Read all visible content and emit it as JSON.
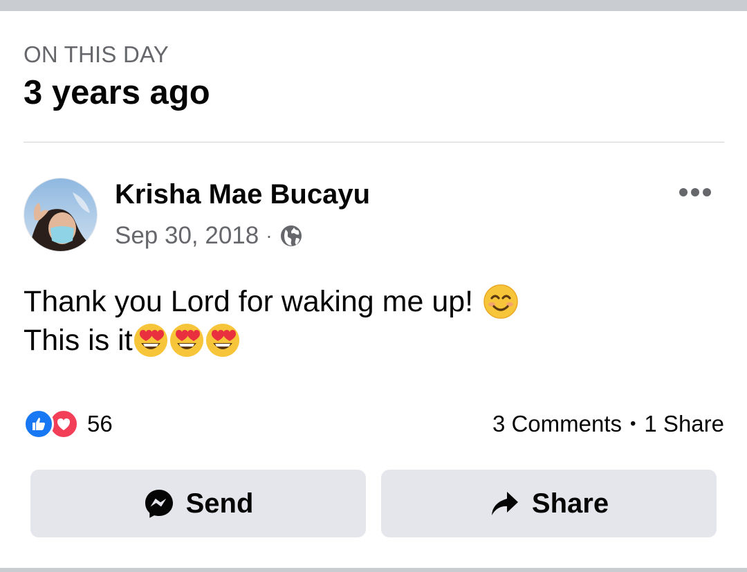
{
  "memory": {
    "label": "ON THIS DAY",
    "title": "3 years ago"
  },
  "post": {
    "author": "Krisha Mae Bucayu",
    "date": "Sep 30, 2018",
    "separator": "·",
    "privacy_icon": "globe-icon",
    "line1": "Thank you Lord for waking me up!",
    "line1_emoji": "smiling-face-with-smiling-eyes",
    "line2": "This is it",
    "line2_emoji": "smiling-face-with-heart-eyes",
    "line2_emoji_count": 3
  },
  "engagement": {
    "reaction_icons": [
      "like-icon",
      "love-icon"
    ],
    "reaction_count": "56",
    "comments": "3 Comments",
    "separator": "•",
    "shares": "1 Share"
  },
  "actions": {
    "send_label": "Send",
    "share_label": "Share"
  },
  "colors": {
    "like_blue": "#1877f2",
    "love_red": "#f33e58",
    "button_bg": "#e4e6eb",
    "secondary_text": "#65676b"
  }
}
